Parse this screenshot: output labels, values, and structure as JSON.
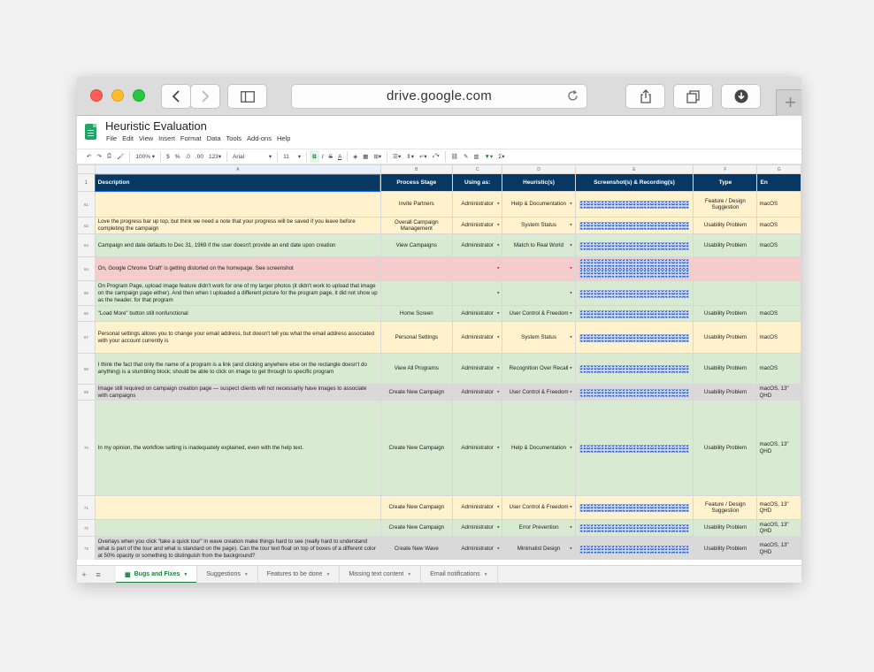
{
  "browser": {
    "url": "drive.google.com",
    "new_tab": "+"
  },
  "sheet": {
    "title": "Heuristic Evaluation",
    "menu": [
      "File",
      "Edit",
      "View",
      "Insert",
      "Format",
      "Data",
      "Tools",
      "Add-ons",
      "Help"
    ],
    "toolbar": {
      "zoom": "100%",
      "currency": "$",
      "percent": "%",
      "decimal_less": ".0",
      "decimal_more": ".00",
      "number_format": "123",
      "font": "Arial",
      "font_size": "11",
      "bold": "B",
      "italic": "I",
      "strike": "S",
      "text_color": "A",
      "sum": "Σ"
    },
    "columns": [
      "A",
      "B",
      "C",
      "D",
      "E",
      "F",
      "G"
    ],
    "header_row": {
      "num": "1",
      "cells": [
        "Description",
        "Process Stage",
        "Using as:",
        "Heuristic(s)",
        "Screenshot(s) & Recording(s)",
        "Type",
        "En"
      ]
    },
    "rows": [
      {
        "num": "61",
        "color": "y",
        "desc": "",
        "redacted": true,
        "stage": "Invite Partners",
        "using": "Administrator",
        "heuristic": "Help & Documentation",
        "type": "Feature / Design Suggestion",
        "env": "macOS"
      },
      {
        "num": "62",
        "color": "y",
        "desc": "Love the progress bar up top, but think we need a note that your progress will be saved if you leave before completing the campaign",
        "stage": "Overall Campaign Management",
        "using": "Administrator",
        "heuristic": "System Status",
        "type": "Usability Problem",
        "env": "macOS"
      },
      {
        "num": "63",
        "color": "g",
        "desc": "Campaign end date defaults to Dec 31, 1969 if the user doesn't provide an end date upon creation",
        "stage": "View Campaigns",
        "using": "Administrator",
        "heuristic": "Match to Real World",
        "type": "Usability Problem",
        "env": "macOS"
      },
      {
        "num": "64",
        "color": "r",
        "desc": "On, Google Chrome 'Draft' is getting distorted on the homepage. See screenshot",
        "stage": "",
        "using": "",
        "heuristic": "",
        "type": "",
        "env": ""
      },
      {
        "num": "65",
        "color": "g",
        "desc": "On Program Page, upload image feature didn't work for one of my larger photos (it didn't work to upload that image on the campaign page either). And then when I uploaded a different picture for the program page, it did not show up as the header. for that program",
        "stage": "",
        "using": "",
        "heuristic": "",
        "type": "",
        "env": ""
      },
      {
        "num": "66",
        "color": "g",
        "desc": "\"Load More\" button still nonfunctional",
        "stage": "Home Screen",
        "using": "Administrator",
        "heuristic": "User Control & Freedom",
        "type": "Usability Problem",
        "env": "macOS"
      },
      {
        "num": "67",
        "color": "y",
        "desc": "Personal settings allows you to change your email address, but doesn't tell you what the email address associated with your account currently is",
        "stage": "Personal Settings",
        "using": "Administrator",
        "heuristic": "System Status",
        "type": "Usability Problem",
        "env": "macOS"
      },
      {
        "num": "68",
        "color": "g",
        "desc": "I think the fact that only the name of a program is a link (and clicking anywhere else on the rectangle doesn't do anything) is a stumbling block; should be able to click on image to get through to specific program",
        "stage": "View All Programs",
        "using": "Administrator",
        "heuristic": "Recognition Over Recall",
        "type": "Usability Problem",
        "env": "macOS"
      },
      {
        "num": "69",
        "color": "gr",
        "desc": "Image still required on campaign creation page — suspect clients will not necessarily have images to associate with campaigns",
        "stage": "Create New Campaign",
        "using": "Administrator",
        "heuristic": "User Control & Freedom",
        "type": "Usability Problem",
        "env": "macOS, 13\" QHD"
      },
      {
        "num": "70",
        "color": "g",
        "desc": "In my opinion, the workflow setting is inadequately explained, even with the help text.",
        "stage": "Create New Campaign",
        "using": "Administrator",
        "heuristic": "Help & Documentation",
        "type": "Usability Problem",
        "env": "macOS, 13\" QHD"
      },
      {
        "num": "71",
        "color": "y",
        "desc": "",
        "redacted": true,
        "stage": "Create New Campaign",
        "using": "Administrator",
        "heuristic": "User Control & Freedom",
        "type": "Feature / Design Suggestion",
        "env": "macOS, 13\" QHD"
      },
      {
        "num": "72",
        "color": "g",
        "desc": "",
        "redacted": true,
        "stage": "Create New Campaign",
        "using": "Administrator",
        "heuristic": "Error Prevention",
        "type": "Usability Problem",
        "env": "macOS, 13\" QHD"
      },
      {
        "num": "73",
        "color": "gr",
        "desc": "Overlays when you click \"take a quick tour\" in wave creation make things hard to see (really hard to understand what is part of the tour and what is standard on the page). Can the tour text float on top of boxes of a different color at 50% opacity or something to distinguish from the background?",
        "stage": "Create New Wave",
        "using": "Administrator",
        "heuristic": "Minimalist Design",
        "type": "Usability Problem",
        "env": "macOS, 13\" QHD"
      }
    ],
    "tabs": [
      "Bugs and Fixes",
      "Suggestions",
      "Features to be done",
      "Missing text content",
      "Email notifications"
    ]
  },
  "colors": {
    "header_bg": "#073763",
    "yellow": "#fff2cc",
    "green": "#d9ead3",
    "red": "#f4cccc",
    "gray": "#d9d9d9",
    "sheets_green": "#188038"
  }
}
